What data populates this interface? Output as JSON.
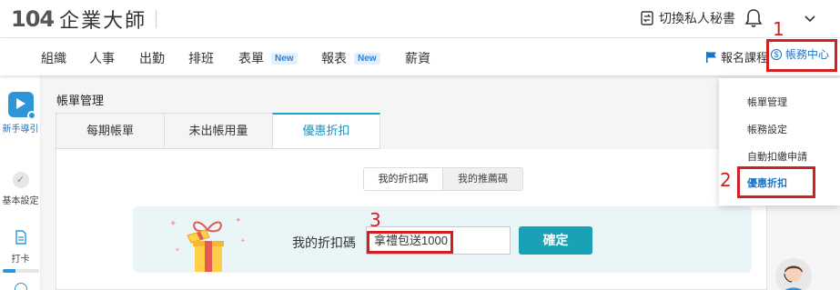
{
  "header": {
    "logo_number": "104",
    "logo_text": "企業大師",
    "switch_label": "切換私人秘書"
  },
  "nav": {
    "items": [
      {
        "label": "組織"
      },
      {
        "label": "人事"
      },
      {
        "label": "出勤"
      },
      {
        "label": "排班"
      },
      {
        "label": "表單",
        "badge": "New"
      },
      {
        "label": "報表",
        "badge": "New"
      },
      {
        "label": "薪資"
      }
    ],
    "course_label": "報名課程",
    "account_center_label": "帳務中心"
  },
  "sidebar": {
    "items": [
      {
        "label": "新手導引"
      },
      {
        "label": "基本設定"
      },
      {
        "label": "打卡",
        "progress": 0.35
      }
    ]
  },
  "page": {
    "title": "帳單管理",
    "tabs": [
      {
        "label": "每期帳單"
      },
      {
        "label": "未出帳用量"
      },
      {
        "label": "優惠折扣",
        "active": true
      }
    ],
    "toggles": [
      {
        "label": "我的折扣碼",
        "active": true
      },
      {
        "label": "我的推薦碼"
      }
    ],
    "code_label": "我的折扣碼",
    "code_value": "拿禮包送1000",
    "confirm_label": "確定"
  },
  "dropdown": {
    "items": [
      {
        "label": "帳單管理"
      },
      {
        "label": "帳務設定"
      },
      {
        "label": "自動扣繳申請"
      },
      {
        "label": "優惠折扣",
        "active": true
      }
    ]
  },
  "annotations": {
    "step1": "1",
    "step2": "2",
    "step3": "3"
  },
  "colors": {
    "accent": "#19a1b5",
    "link": "#1a73c8",
    "highlight": "#d21f1f",
    "logo_o": "#f29900"
  }
}
